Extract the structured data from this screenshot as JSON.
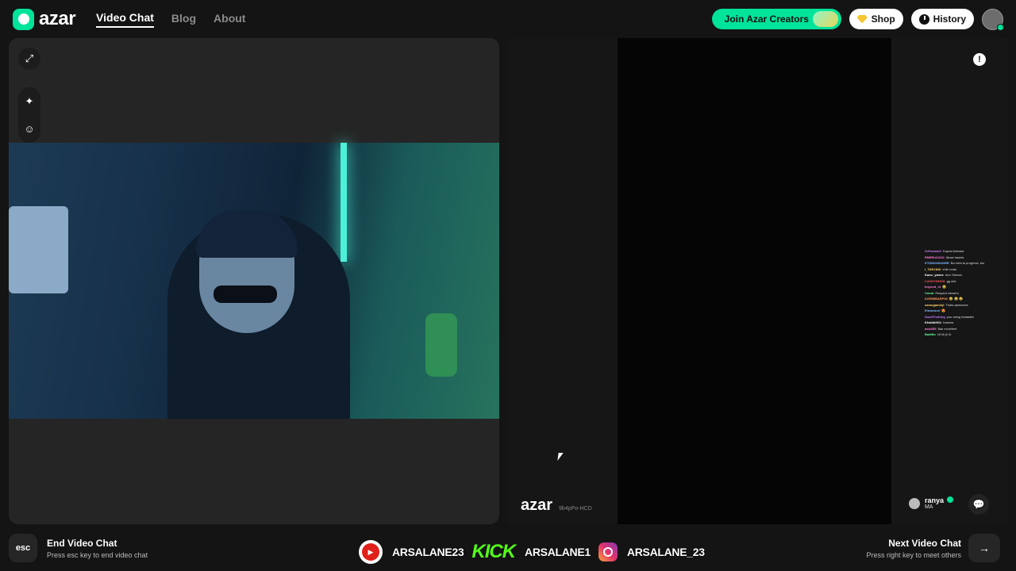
{
  "brand": {
    "name": "azar"
  },
  "nav": {
    "items": [
      {
        "label": "Video Chat",
        "active": true
      },
      {
        "label": "Blog"
      },
      {
        "label": "About"
      }
    ]
  },
  "header": {
    "creators_label": "Join Azar Creators",
    "shop_label": "Shop",
    "history_label": "History"
  },
  "left_panel": {
    "icons": [
      "expand-icon",
      "sparkle-effects-icon",
      "sticker-face-icon"
    ]
  },
  "remote": {
    "watermark": "azar",
    "session_id": "9b4pPo-HCD",
    "user_name": "ranya",
    "user_country": "MA",
    "chat_overlay": [
      {
        "user": "XxFandarX",
        "msg": "Kayna tbeeska",
        "color": "#c77dff"
      },
      {
        "user": "EMIRKA2232",
        "msg": "Akwa hawrts",
        "color": "#ff7ad9"
      },
      {
        "user": "KTDM4446AMIR",
        "msg": "Ba mrta la progress, ktu",
        "color": "#7db8ff"
      },
      {
        "user": "I_TARJANI",
        "msg": "chill mode",
        "color": "#ffd36b"
      },
      {
        "user": "Kano_yanne",
        "msg": "Alor Stream",
        "color": "#ffffff"
      },
      {
        "user": "LUCKYGHOS",
        "msg": "gg slot",
        "color": "#ff5b5b"
      },
      {
        "user": "bnyovd_ni",
        "msg": "😂",
        "color": "#ff7ad9"
      },
      {
        "user": "Cmnb",
        "msg": "Respect viewers",
        "color": "#6bff9a"
      },
      {
        "user": "KARIMBARP92",
        "msg": "😂 😂 😂",
        "color": "#ff9b5b"
      },
      {
        "user": "xamogaminjl",
        "msg": "Thats awesome",
        "color": "#ffd36b"
      },
      {
        "user": "Elmansuri",
        "msg": "😍",
        "color": "#7db8ff"
      },
      {
        "user": "SoullTheKing",
        "msg": "you doing fantastic!",
        "color": "#c77dff"
      },
      {
        "user": "Khalidb911",
        "msg": "hasbna",
        "color": "#ffffff"
      },
      {
        "user": "asal455",
        "msg": "Bak excellent",
        "color": "#ff7ad9"
      },
      {
        "user": "Baditto",
        "msg": "16 lik jh ik",
        "color": "#6bff9a"
      }
    ]
  },
  "bottom": {
    "esc_key": "esc",
    "end_title": "End Video Chat",
    "end_sub": "Press esc key to end video chat",
    "next_title": "Next Video Chat",
    "next_sub": "Press right key to meet others",
    "next_key": "→"
  },
  "socials": [
    {
      "platform": "youtube",
      "handle": "ARSALANE23"
    },
    {
      "platform": "kick",
      "logo_text": "KICK",
      "handle": "ARSALANE1"
    },
    {
      "platform": "instagram",
      "handle": "ARSALANE_23"
    }
  ],
  "colors": {
    "accent": "#00e39a",
    "background": "#141414",
    "panel": "#252525"
  }
}
